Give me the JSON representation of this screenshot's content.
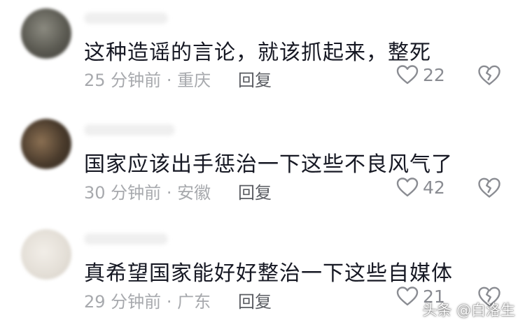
{
  "comments": [
    {
      "text": "这种造谣的言论，就该抓起来，整死",
      "time": "25 分钟前",
      "location": "重庆",
      "reply_label": "回复",
      "likes": "22",
      "avatar_color": "#5b5a52"
    },
    {
      "text": "国家应该出手惩治一下这些不良风气了",
      "time": "30 分钟前",
      "location": "安徽",
      "reply_label": "回复",
      "likes": "42",
      "avatar_color": "#4a3b2c"
    },
    {
      "text": "真希望国家能好好整治一下这些自媒体",
      "time": "29 分钟前",
      "location": "广东",
      "reply_label": "回复",
      "likes": "21",
      "avatar_color": "#e3ded6"
    }
  ],
  "meta_separator": "·",
  "watermark": "头条 @白洛生",
  "icons": {
    "like": "heart-icon",
    "dislike": "broken-heart-icon"
  }
}
